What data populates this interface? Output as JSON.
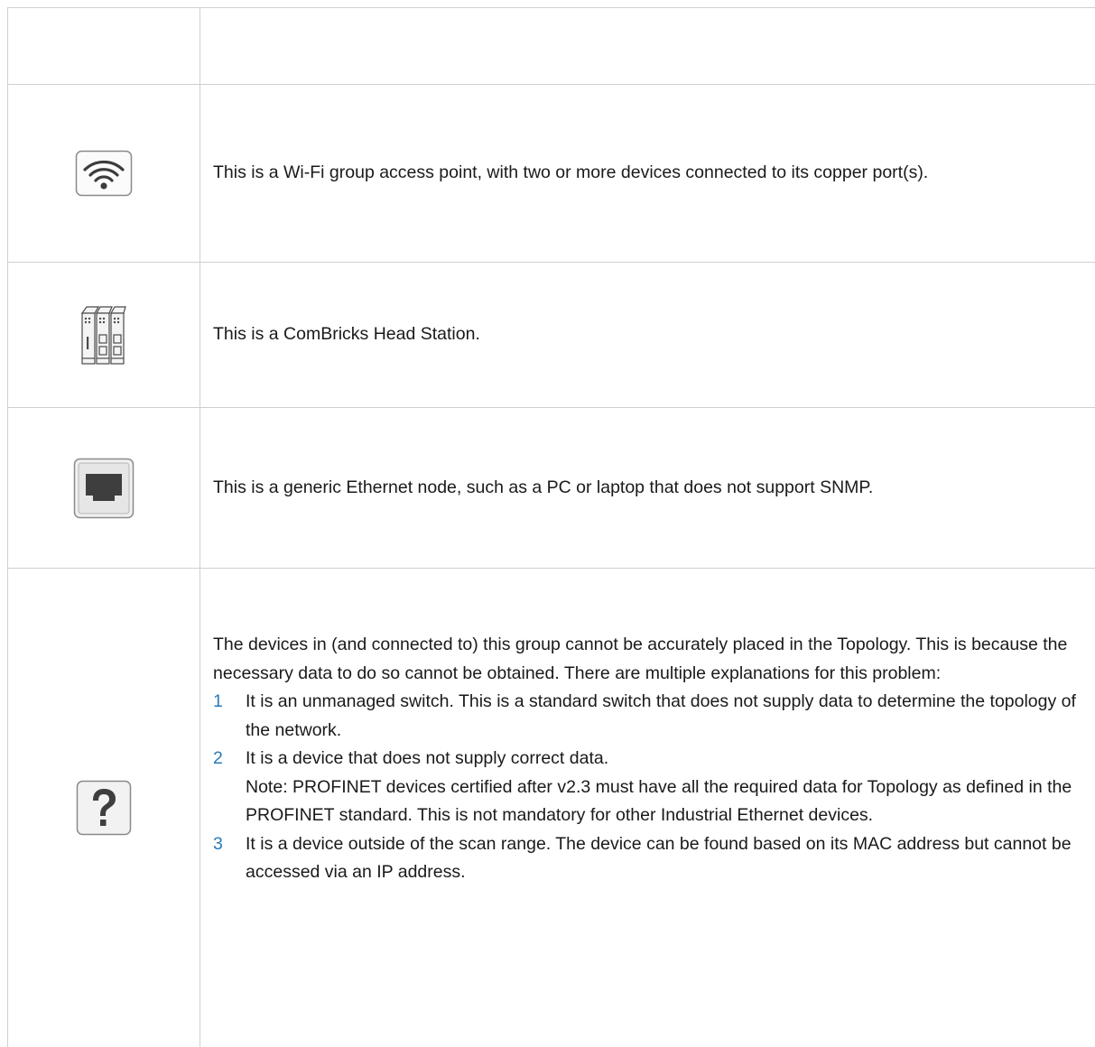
{
  "rows": [
    {
      "icon": "",
      "text": ""
    },
    {
      "icon": "wifi-access-point-icon",
      "text": "This is a Wi-Fi group access point, with two or more devices connected to its copper port(s)."
    },
    {
      "icon": "combricks-head-station-icon",
      "text": "This is a ComBricks Head Station."
    },
    {
      "icon": "ethernet-node-icon",
      "text": "This is a generic Ethernet node, such as a PC or laptop that does not support SNMP."
    },
    {
      "icon": "unknown-device-question-icon",
      "intro": "The devices in (and connected to) this group cannot be accurately placed in the Topology. This is because the necessary data to do so cannot be obtained. There are multiple explanations for this problem:",
      "items": [
        {
          "num": "1",
          "text": "It is an unmanaged switch. This is a standard switch that does not supply data to determine the topology of the network."
        },
        {
          "num": "2",
          "text": "It is a device that does not supply correct data.",
          "note": "Note: PROFINET devices certified after v2.3 must have all the required data for Topology as defined in the PROFINET standard. This is not mandatory for other Industrial Ethernet devices."
        },
        {
          "num": "3",
          "text": "It is a device outside of the scan range. The device can be found based on its MAC address but cannot be accessed via an IP address."
        }
      ]
    }
  ],
  "colors": {
    "border": "#cfcfcf",
    "list_number": "#2a7ab8",
    "icon_stroke": "#5a5a5a"
  }
}
